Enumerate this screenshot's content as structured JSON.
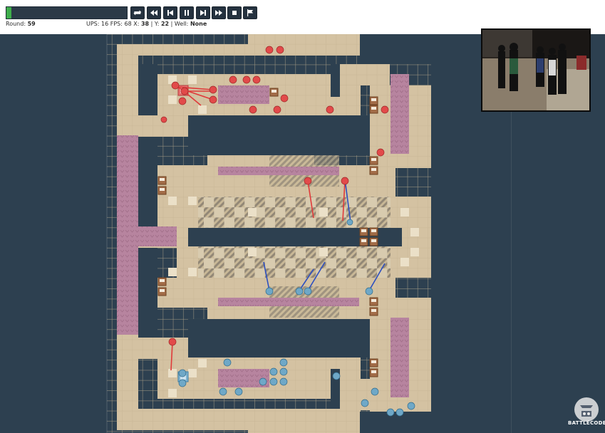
{
  "progress": {
    "fraction": 0.04,
    "fill_color": "#3fae4b"
  },
  "controls": [
    {
      "name": "swap-icon",
      "label": ""
    },
    {
      "name": "rewind-icon",
      "label": ""
    },
    {
      "name": "step-back-icon",
      "label": ""
    },
    {
      "name": "pause-icon",
      "label": ""
    },
    {
      "name": "step-forward-icon",
      "label": ""
    },
    {
      "name": "fast-forward-icon",
      "label": ""
    },
    {
      "name": "stop-icon",
      "label": ""
    },
    {
      "name": "flag-icon",
      "label": ""
    }
  ],
  "stats": {
    "round_label": "Round:",
    "round": "59",
    "ups_label": "UPS:",
    "ups": "16",
    "fps_label": "FPS:",
    "fps": "68",
    "x_label": "X:",
    "x": "38",
    "y_label": "Y:",
    "y": "22",
    "well_label": "Well:",
    "well": "None"
  },
  "map": {
    "background": "#2d4050",
    "floor_color": "#d4c2a2",
    "wall_color": "#2d4050",
    "cloud_color": "#9a8f7d",
    "current_color": "#b67a9e",
    "red_team_color": "#e24a4a",
    "blue_team_color": "#6fa8c7"
  },
  "logo": {
    "text": "BATTLECODE"
  }
}
